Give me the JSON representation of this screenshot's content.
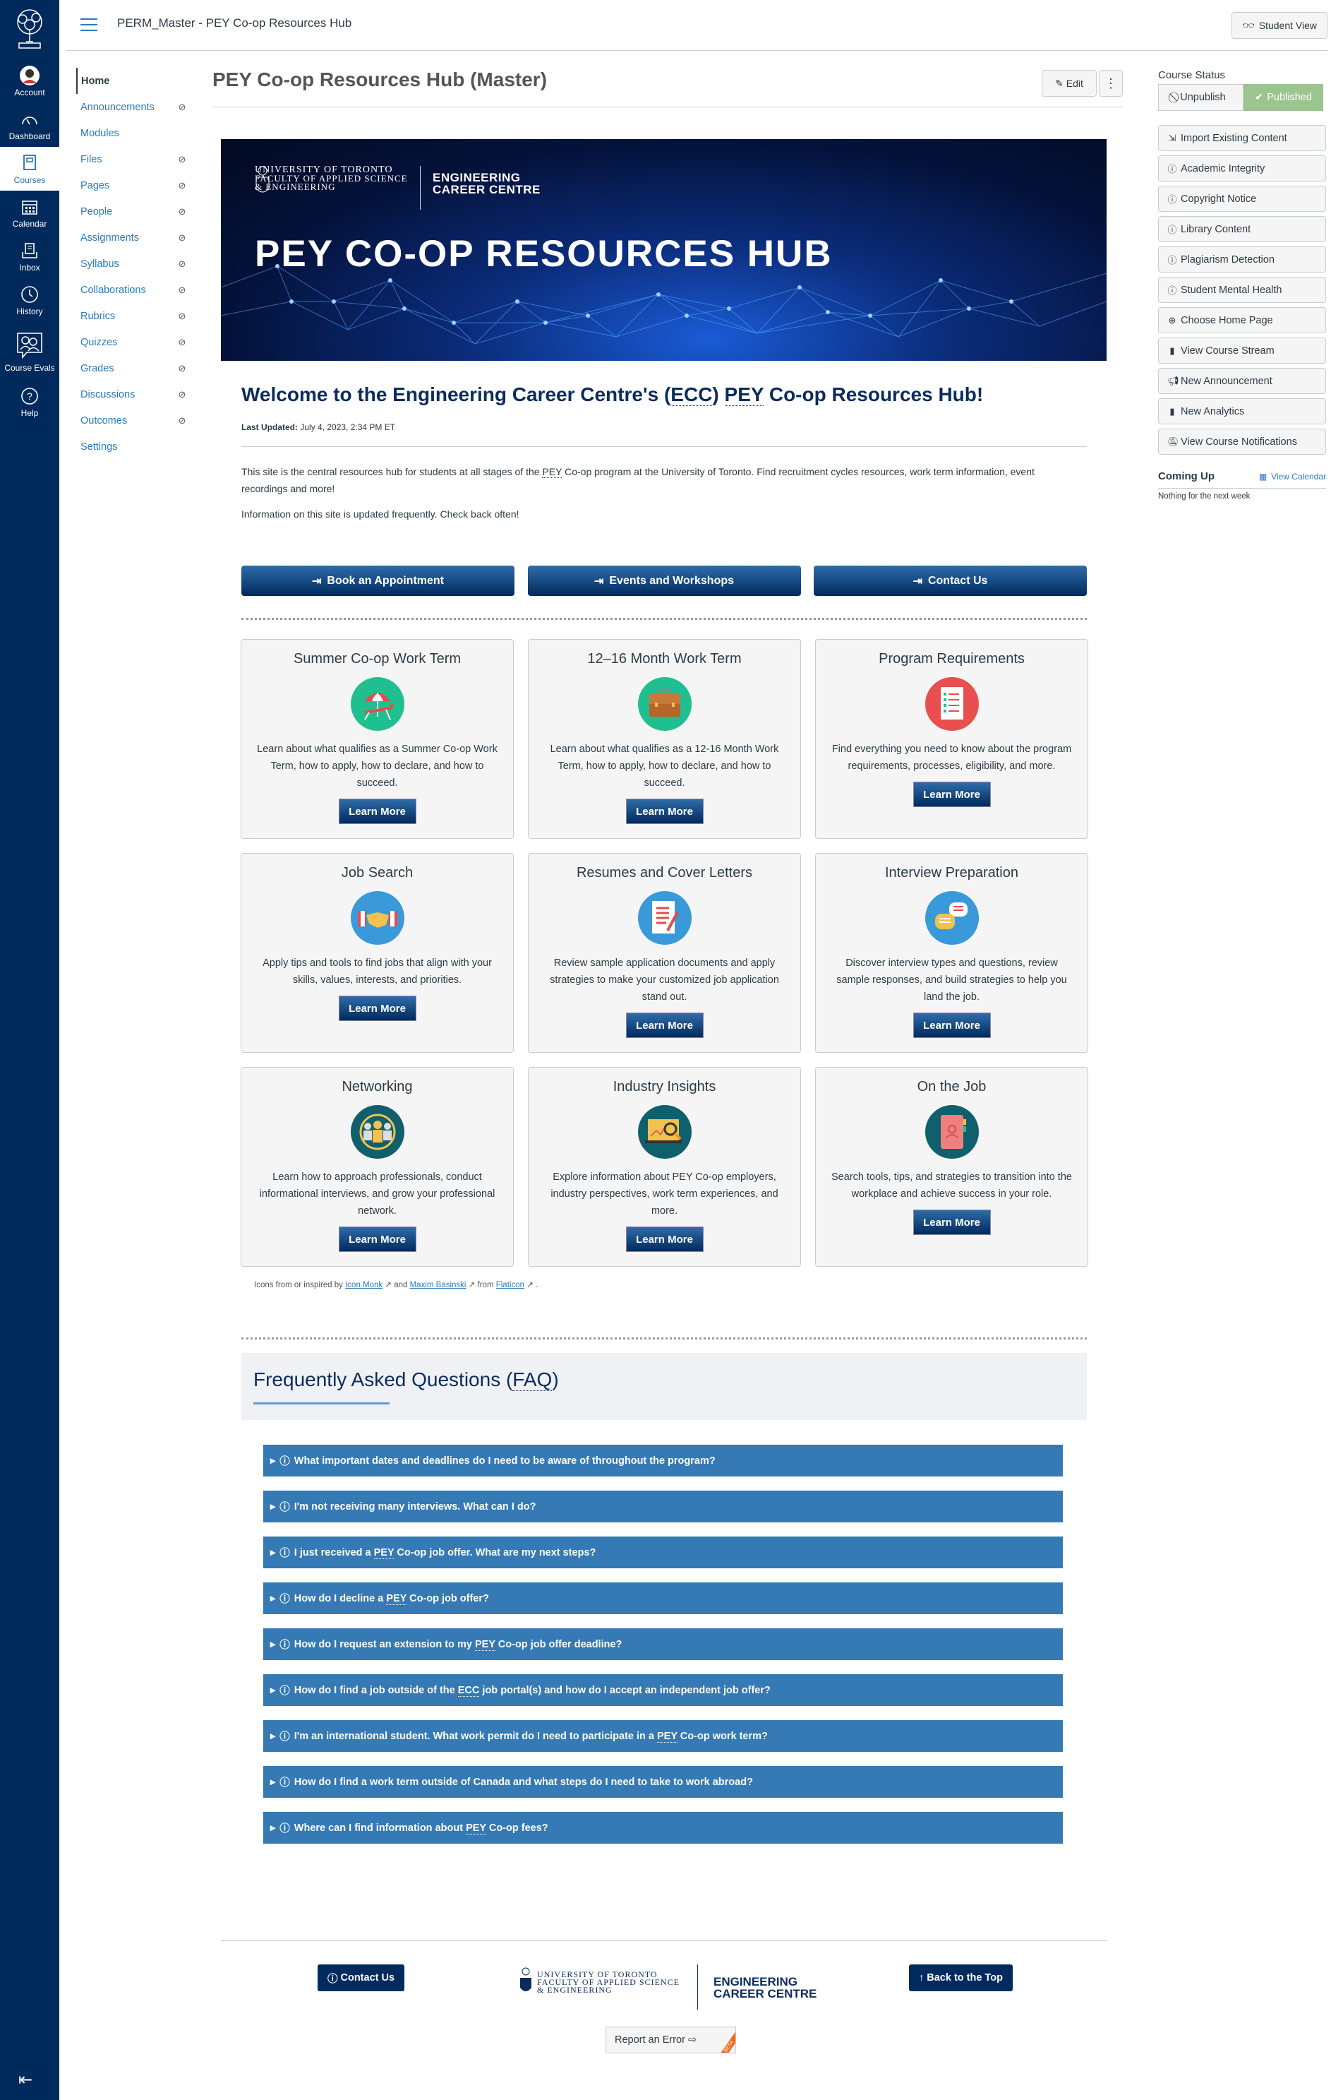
{
  "global_nav": {
    "items": [
      {
        "label": "Account",
        "icon": "avatar"
      },
      {
        "label": "Dashboard",
        "icon": "dashboard-icon"
      },
      {
        "label": "Courses",
        "icon": "courses-icon",
        "active": true
      },
      {
        "label": "Calendar",
        "icon": "calendar-icon"
      },
      {
        "label": "Inbox",
        "icon": "inbox-icon"
      },
      {
        "label": "History",
        "icon": "history-icon"
      },
      {
        "label": "Course Evals",
        "icon": "course-evals-icon"
      },
      {
        "label": "Help",
        "icon": "help-icon"
      }
    ],
    "collapse_icon": "collapse-nav-icon"
  },
  "topbar": {
    "breadcrumb": "PERM_Master - PEY Co-op Resources Hub",
    "student_view": "Student View"
  },
  "course_nav": {
    "items": [
      {
        "label": "Home",
        "active": true,
        "hidden": false
      },
      {
        "label": "Announcements",
        "hidden": true
      },
      {
        "label": "Modules",
        "hidden": false
      },
      {
        "label": "Files",
        "hidden": true
      },
      {
        "label": "Pages",
        "hidden": true
      },
      {
        "label": "People",
        "hidden": true
      },
      {
        "label": "Assignments",
        "hidden": true
      },
      {
        "label": "Syllabus",
        "hidden": true
      },
      {
        "label": "Collaborations",
        "hidden": true
      },
      {
        "label": "Rubrics",
        "hidden": true
      },
      {
        "label": "Quizzes",
        "hidden": true
      },
      {
        "label": "Grades",
        "hidden": true
      },
      {
        "label": "Discussions",
        "hidden": true
      },
      {
        "label": "Outcomes",
        "hidden": true
      },
      {
        "label": "Settings",
        "hidden": false
      }
    ]
  },
  "page": {
    "title": "PEY Co-op Resources Hub (Master)",
    "edit_label": "Edit",
    "more_label": "⋮"
  },
  "banner": {
    "uoft_line1": "UNIVERSITY OF TORONTO",
    "uoft_line2": "FACULTY OF APPLIED SCIENCE",
    "uoft_line3": "& ENGINEERING",
    "ecc_line1": "ENGINEERING",
    "ecc_line2": "CAREER CENTRE",
    "title": "PEY CO-OP RESOURCES HUB"
  },
  "welcome": {
    "heading_pre": "Welcome to the Engineering Career Centre's (",
    "heading_abbr1": "ECC",
    "heading_mid": ") ",
    "heading_abbr2": "PEY",
    "heading_post": " Co-op Resources Hub!",
    "updated_label": "Last Updated:",
    "updated_value": " July 4, 2023, 2:34 PM ET",
    "intro_pre": "This site is the central resources hub for students at all stages of the ",
    "intro_abbr": "PEY",
    "intro_post": " Co-op program at the University of Toronto. Find recruitment cycles resources, work term information, event recordings and more!",
    "intro2": "Information on this site is updated frequently. Check back often!"
  },
  "action_buttons": [
    {
      "label": "Book an Appointment"
    },
    {
      "label": "Events and Workshops"
    },
    {
      "label": "Contact Us"
    }
  ],
  "cards": [
    {
      "title": "Summer Co-op Work Term",
      "icon": "beach-chair-icon",
      "desc": "Learn about what qualifies as a Summer Co-op Work Term, how to apply, how to declare, and how to succeed.",
      "button": "Learn More"
    },
    {
      "title": "12–16 Month Work Term",
      "icon": "briefcase-icon",
      "desc": "Learn about what qualifies as a 12-16 Month Work Term, how to apply, how to declare, and how to succeed.",
      "button": "Learn More"
    },
    {
      "title": "Program Requirements",
      "icon": "checklist-icon",
      "desc": "Find everything you need to know about the program requirements, processes, eligibility, and more.",
      "button": "Learn More"
    },
    {
      "title": "Job Search",
      "icon": "handshake-icon",
      "desc": "Apply tips and tools to find jobs that align with your skills, values, interests, and priorities.",
      "button": "Learn More"
    },
    {
      "title": "Resumes and Cover Letters",
      "icon": "document-pen-icon",
      "desc": "Review sample application documents and apply strategies to make your customized job application stand out.",
      "button": "Learn More"
    },
    {
      "title": "Interview Preparation",
      "icon": "chat-bubbles-icon",
      "desc": "Discover interview types and questions, review sample responses, and build strategies to help you land the job.",
      "button": "Learn More"
    },
    {
      "title": "Networking",
      "icon": "network-people-icon",
      "desc": "Learn how to approach professionals, conduct informational interviews, and grow your professional network.",
      "button": "Learn More"
    },
    {
      "title": "Industry Insights",
      "icon": "magnifier-chart-icon",
      "desc": "Explore information about PEY Co-op employers, industry perspectives, work term experiences, and more.",
      "button": "Learn More"
    },
    {
      "title": "On the Job",
      "icon": "notebook-icon",
      "desc": "Search tools, tips, and strategies to transition into the workplace and achieve success in your role.",
      "button": "Learn More"
    }
  ],
  "credits": {
    "pre": "Icons from or inspired by ",
    "link1": "Icon Monk",
    "mid": " and ",
    "link2": "Maxim Basinski",
    "mid2": " from ",
    "link3": "Flaticon",
    "post": " ."
  },
  "faq": {
    "heading_pre": "Frequently Asked Questions (",
    "heading_abbr": "FAQ",
    "heading_post": ")",
    "items": [
      {
        "pre": "What important dates and deadlines do I need to be aware of throughout the program?",
        "abbr": "",
        "post": ""
      },
      {
        "pre": "I'm not receiving many interviews. What can I do?",
        "abbr": "",
        "post": ""
      },
      {
        "pre": "I just received a ",
        "abbr": "PEY",
        "post": " Co-op job offer. What are my next steps?"
      },
      {
        "pre": "How do I decline a ",
        "abbr": "PEY",
        "post": " Co-op job offer?"
      },
      {
        "pre": "How do I request an extension to my ",
        "abbr": "PEY",
        "post": " Co-op job offer deadline?"
      },
      {
        "pre": "How do I find a job outside of the ",
        "abbr": "ECC",
        "post": " job portal(s) and how do I accept an independent job offer?"
      },
      {
        "pre": "I'm an international student. What work permit do I need to participate in a ",
        "abbr": "PEY",
        "post": " Co-op work term?"
      },
      {
        "pre": "How do I find a work term outside of Canada and what steps do I need to take to work abroad?",
        "abbr": "",
        "post": ""
      },
      {
        "pre": "Where can I find information about ",
        "abbr": "PEY",
        "post": " Co-op fees?"
      }
    ]
  },
  "footer": {
    "contact": "Contact Us",
    "back_top": "Back to the Top",
    "uoft_line1": "UNIVERSITY OF TORONTO",
    "uoft_line2": "FACULTY OF APPLIED SCIENCE",
    "uoft_line3": "& ENGINEERING",
    "ecc_line1": "ENGINEERING",
    "ecc_line2": "CAREER CENTRE",
    "report": "Report an Error",
    "beta": "BETA"
  },
  "right_sidebar": {
    "status_title": "Course Status",
    "unpublish": "Unpublish",
    "published": "Published",
    "published_color": "#9bc48f",
    "buttons": [
      {
        "label": "Import Existing Content",
        "icon": "import-icon"
      },
      {
        "label": "Academic Integrity",
        "icon": "info-icon"
      },
      {
        "label": "Copyright Notice",
        "icon": "info-icon"
      },
      {
        "label": "Library Content",
        "icon": "info-icon"
      },
      {
        "label": "Plagiarism Detection",
        "icon": "info-icon"
      },
      {
        "label": "Student Mental Health",
        "icon": "info-icon"
      },
      {
        "label": "Choose Home Page",
        "icon": "target-icon"
      },
      {
        "label": "View Course Stream",
        "icon": "bar-chart-icon"
      },
      {
        "label": "New Announcement",
        "icon": "megaphone-icon"
      },
      {
        "label": "New Analytics",
        "icon": "bar-chart-icon"
      },
      {
        "label": "View Course Notifications",
        "icon": "bell-off-icon"
      }
    ],
    "coming_up": "Coming Up",
    "view_calendar": "View Calendar",
    "nothing": "Nothing for the next week"
  },
  "colors": {
    "nav_bg": "#002a5c",
    "link": "#2a7abf",
    "faq_bg": "#3579b5",
    "button_dark": "#012a5e"
  }
}
